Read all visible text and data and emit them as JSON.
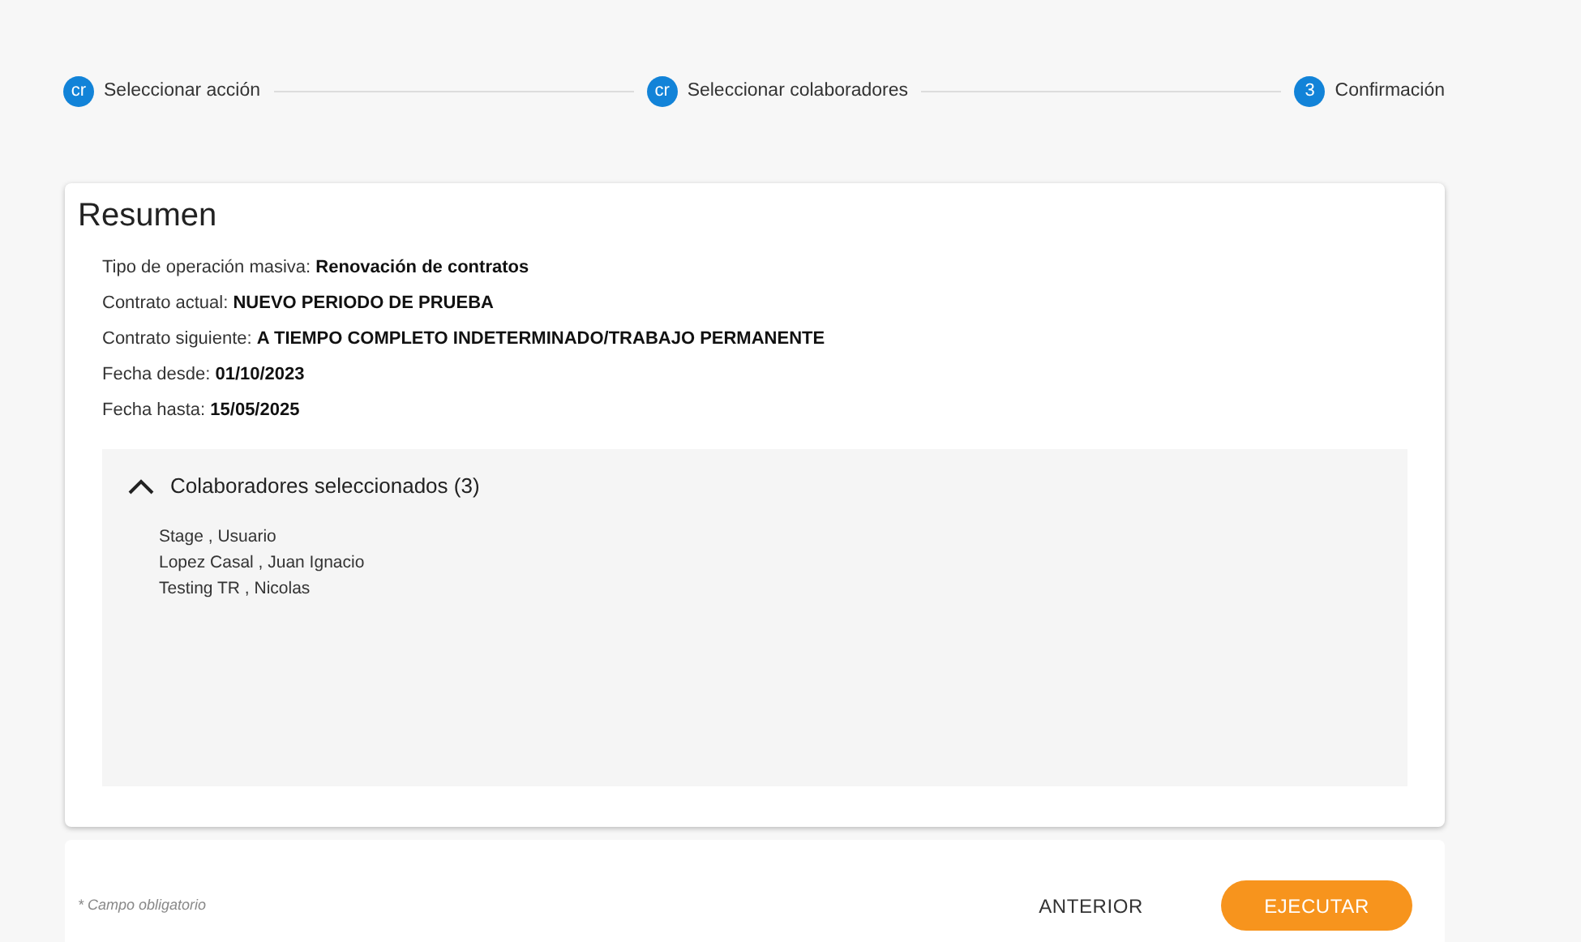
{
  "stepper": [
    {
      "badge": "cr",
      "label": "Seleccionar acción"
    },
    {
      "badge": "cr",
      "label": "Seleccionar colaboradores"
    },
    {
      "badge": "3",
      "label": "Confirmación"
    }
  ],
  "summary": {
    "title": "Resumen",
    "fields": [
      {
        "label": "Tipo de operación masiva:",
        "value": "Renovación de contratos"
      },
      {
        "label": "Contrato actual:",
        "value": "NUEVO PERIODO DE PRUEBA"
      },
      {
        "label": "Contrato siguiente:",
        "value": "A TIEMPO COMPLETO INDETERMINADO/TRABAJO PERMANENTE"
      },
      {
        "label": "Fecha desde:",
        "value": "01/10/2023"
      },
      {
        "label": "Fecha hasta:",
        "value": "15/05/2025"
      }
    ],
    "collaborators": {
      "title": "Colaboradores seleccionados (3)",
      "expanded": true,
      "items": [
        "Stage , Usuario",
        "Lopez Casal , Juan Ignacio",
        "Testing TR , Nicolas"
      ]
    }
  },
  "footer": {
    "note": "* Campo obligatorio",
    "buttons": [
      {
        "label": "ANTERIOR",
        "kind": "text"
      },
      {
        "label": "EJECUTAR",
        "kind": "primary"
      }
    ]
  }
}
